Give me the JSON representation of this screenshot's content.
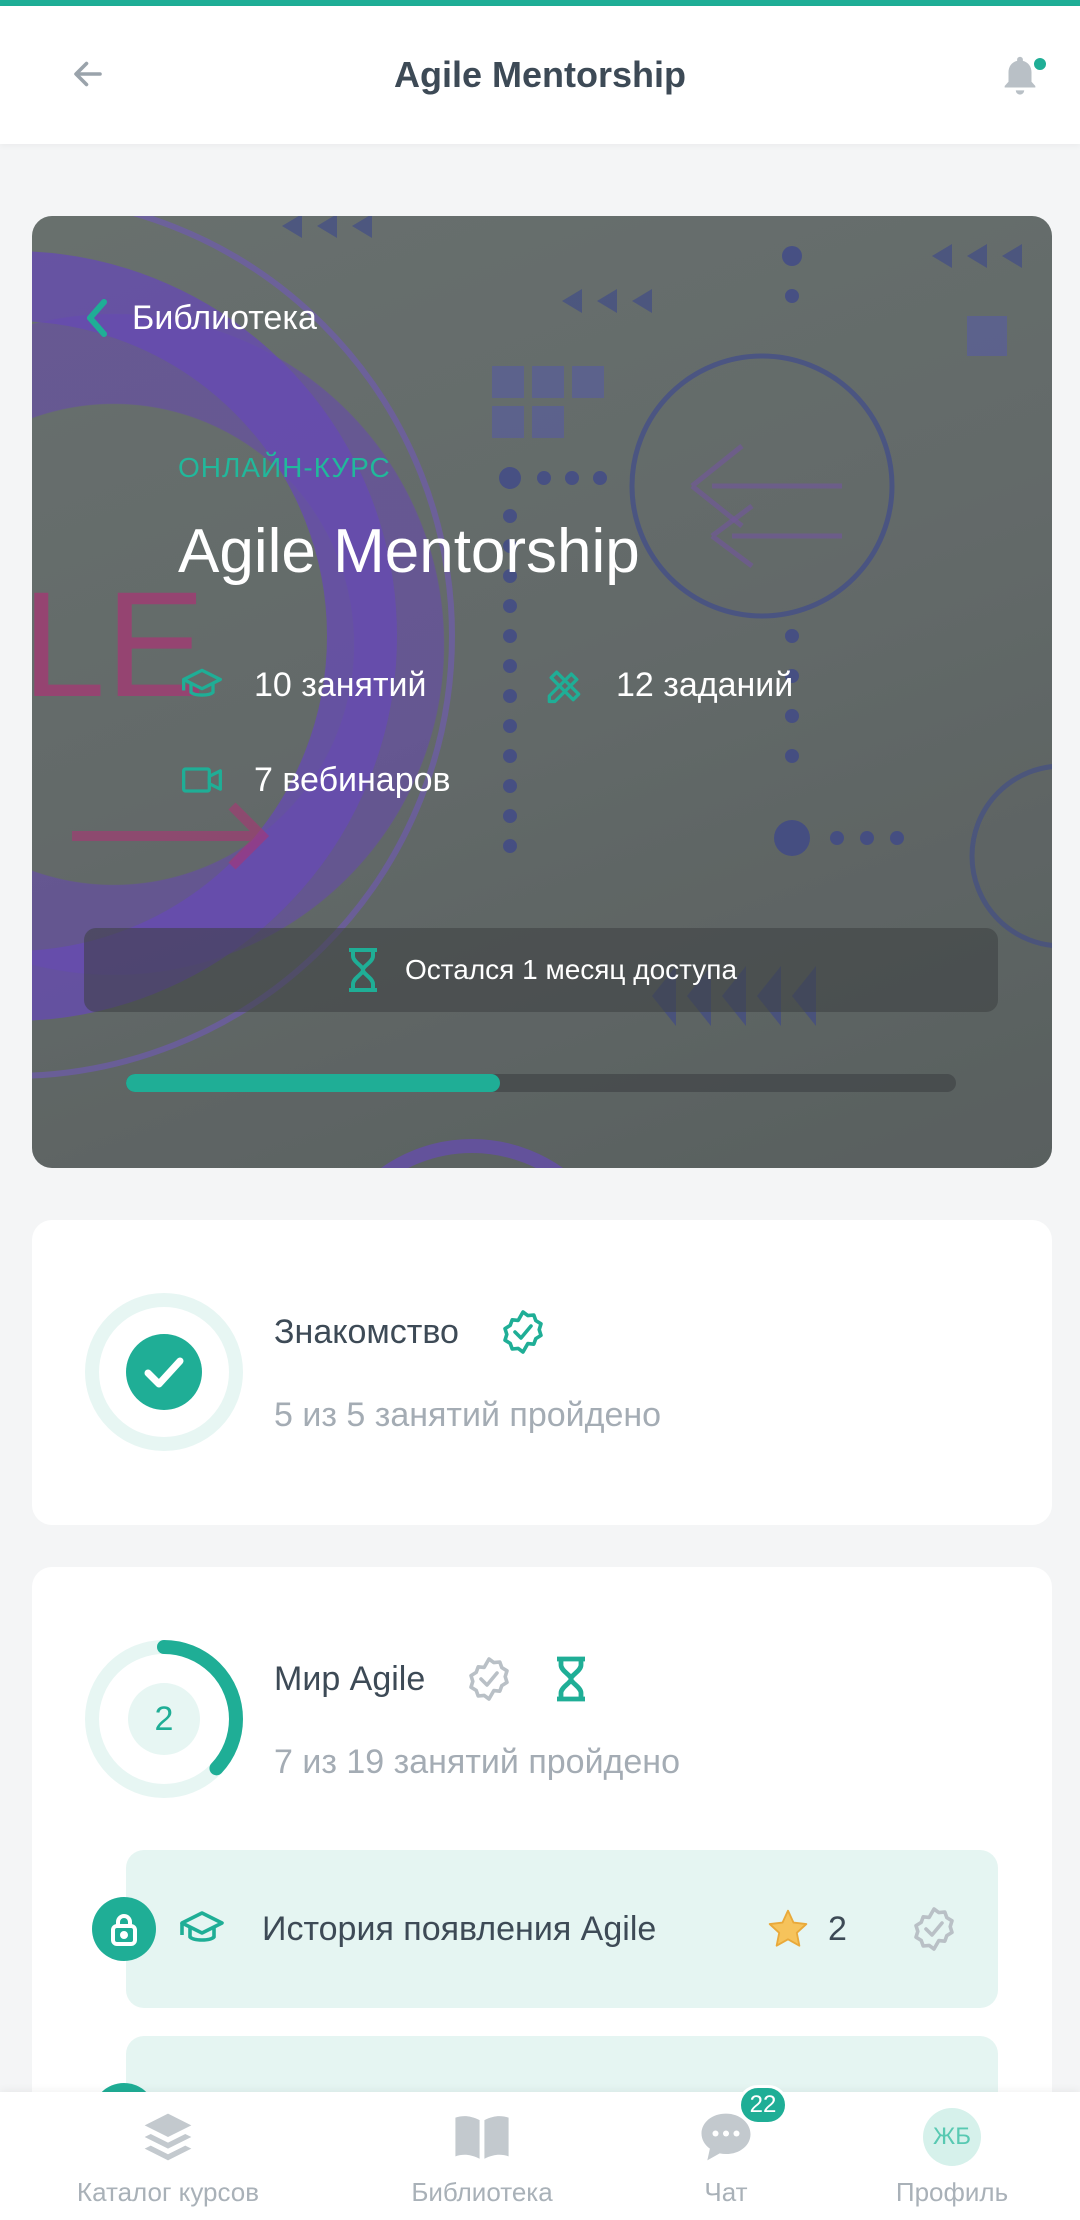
{
  "colors": {
    "accent": "#1fae96",
    "text": "#3d4a56",
    "muted": "#a4acb4",
    "lesson_bg": "#e5f5f2"
  },
  "appbar": {
    "title": "Agile Mentorship",
    "back_icon": "arrow-left-icon",
    "bell_icon": "bell-icon"
  },
  "hero": {
    "back_label": "Библиотека",
    "kicker": "Онлайн-курс",
    "title": "Agile Mentorship",
    "stats": {
      "lessons": "10 занятий",
      "tasks": "12 заданий",
      "webinars": "7 вебинаров"
    },
    "access_text": "Остался 1 месяц доступа",
    "progress": 0.45
  },
  "modules": [
    {
      "name": "Знакомство",
      "subtitle": "5 из 5 занятий пройдено",
      "complete": true,
      "progress": 1.0
    },
    {
      "name": "Мир Agile",
      "subtitle": "7 из 19 занятий пройдено",
      "number": "2",
      "progress": 0.37,
      "lessons": [
        {
          "title": "История появления Agile",
          "rating": "2"
        }
      ]
    }
  ],
  "bottom_nav": {
    "items": [
      {
        "label": "Каталог курсов",
        "icon": "layers-icon"
      },
      {
        "label": "Библиотека",
        "icon": "book-icon"
      },
      {
        "label": "Чат",
        "icon": "chat-icon",
        "badge": "22"
      },
      {
        "label": "Профиль",
        "icon": "avatar",
        "initials": "ЖБ"
      }
    ]
  }
}
